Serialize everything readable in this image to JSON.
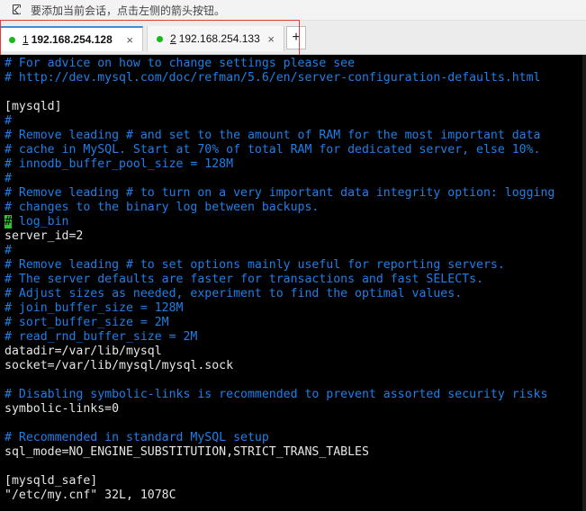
{
  "hint_bar": {
    "text": "要添加当前会话，点击左侧的箭头按钮。"
  },
  "tabs": [
    {
      "num": "1",
      "title": "192.168.254.128",
      "status_color": "#18b818",
      "close": "×",
      "active": true
    },
    {
      "num": "2",
      "title": "192.168.254.133",
      "status_color": "#18b818",
      "close": "×",
      "active": false
    }
  ],
  "add_tab": "+",
  "terminal": {
    "lines": [
      {
        "text": "# For advice on how to change settings please see",
        "type": "comment"
      },
      {
        "text": "# http://dev.mysql.com/doc/refman/5.6/en/server-configuration-defaults.html",
        "type": "comment"
      },
      {
        "text": "",
        "type": "plain"
      },
      {
        "text": "[mysqld]",
        "type": "plain"
      },
      {
        "text": "#",
        "type": "comment"
      },
      {
        "text": "# Remove leading # and set to the amount of RAM for the most important data",
        "type": "comment"
      },
      {
        "text": "# cache in MySQL. Start at 70% of total RAM for dedicated server, else 10%.",
        "type": "comment"
      },
      {
        "text": "# innodb_buffer_pool_size = 128M",
        "type": "comment"
      },
      {
        "text": "#",
        "type": "comment"
      },
      {
        "text": "# Remove leading # to turn on a very important data integrity option: logging",
        "type": "comment"
      },
      {
        "text": "# changes to the binary log between backups.",
        "type": "comment"
      },
      {
        "text": "# log_bin",
        "type": "cursor"
      },
      {
        "text": "server_id=2",
        "type": "plain"
      },
      {
        "text": "#",
        "type": "comment"
      },
      {
        "text": "# Remove leading # to set options mainly useful for reporting servers.",
        "type": "comment"
      },
      {
        "text": "# The server defaults are faster for transactions and fast SELECTs.",
        "type": "comment"
      },
      {
        "text": "# Adjust sizes as needed, experiment to find the optimal values.",
        "type": "comment"
      },
      {
        "text": "# join_buffer_size = 128M",
        "type": "comment"
      },
      {
        "text": "# sort_buffer_size = 2M",
        "type": "comment"
      },
      {
        "text": "# read_rnd_buffer_size = 2M",
        "type": "comment"
      },
      {
        "text": "datadir=/var/lib/mysql",
        "type": "plain"
      },
      {
        "text": "socket=/var/lib/mysql/mysql.sock",
        "type": "plain"
      },
      {
        "text": "",
        "type": "plain"
      },
      {
        "text": "# Disabling symbolic-links is recommended to prevent assorted security risks",
        "type": "comment"
      },
      {
        "text": "symbolic-links=0",
        "type": "plain"
      },
      {
        "text": "",
        "type": "plain"
      },
      {
        "text": "# Recommended in standard MySQL setup",
        "type": "comment"
      },
      {
        "text": "sql_mode=NO_ENGINE_SUBSTITUTION,STRICT_TRANS_TABLES",
        "type": "plain"
      },
      {
        "text": "",
        "type": "plain"
      },
      {
        "text": "[mysqld_safe]",
        "type": "plain"
      },
      {
        "text": "\"/etc/my.cnf\" 32L, 1078C",
        "type": "plain"
      }
    ]
  },
  "colors": {
    "comment": "#1f7fe8",
    "plain": "#e6e6e6",
    "cursor_bg": "#22cc22",
    "terminal_bg": "#000000",
    "active_tab_accent": "#3c8dde",
    "highlight_box": "#e53935"
  }
}
